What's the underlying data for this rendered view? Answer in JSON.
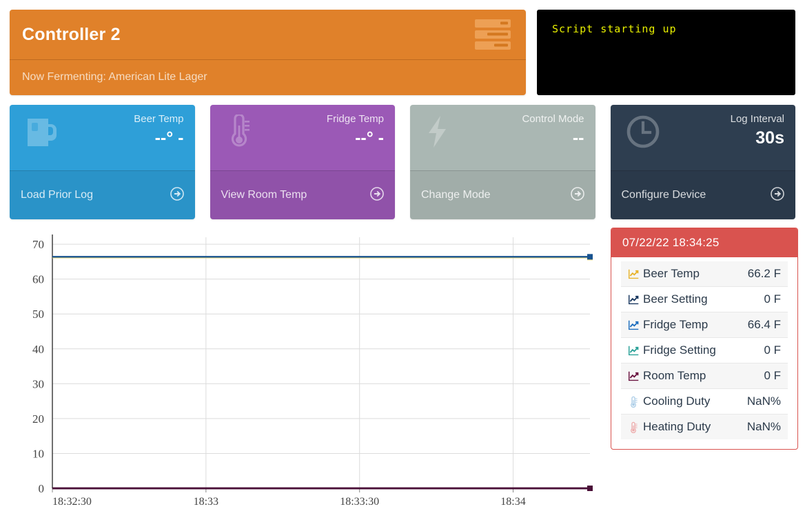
{
  "controller": {
    "title": "Controller 2",
    "subtitle": "Now Fermenting: American Lite Lager",
    "icon": "server-icon",
    "bg_color": "#e0812a"
  },
  "lcd": {
    "line1": "Script starting up",
    "line2": "",
    "line3": "",
    "line4": "",
    "text_color": "#e8f000",
    "bg_color": "#000000"
  },
  "cards": [
    {
      "label": "Beer Temp",
      "value": "--° -",
      "footer": "Load Prior Log",
      "icon": "beer-mug-icon",
      "color": "#2e9fd8"
    },
    {
      "label": "Fridge Temp",
      "value": "--° -",
      "footer": "View Room Temp",
      "icon": "thermometer-icon",
      "color": "#9b59b6"
    },
    {
      "label": "Control Mode",
      "value": "--",
      "footer": "Change Mode",
      "icon": "lightning-bolt-icon",
      "color": "#aab7b3"
    },
    {
      "label": "Log Interval",
      "value": "30s",
      "footer": "Configure Device",
      "icon": "clock-icon",
      "color": "#2e3e50"
    }
  ],
  "panel": {
    "timestamp": "07/22/22 18:34:25",
    "header_color": "#d9534f",
    "rows": [
      {
        "label": "Beer Temp",
        "value": "66.2 F",
        "icon": "chart-line-icon",
        "icon_color": "#e8b42e"
      },
      {
        "label": "Beer Setting",
        "value": "0 F",
        "icon": "chart-line-icon",
        "icon_color": "#18375f"
      },
      {
        "label": "Fridge Temp",
        "value": "66.4 F",
        "icon": "chart-line-icon",
        "icon_color": "#1f6fbf"
      },
      {
        "label": "Fridge Setting",
        "value": "0 F",
        "icon": "chart-line-icon",
        "icon_color": "#2aa198"
      },
      {
        "label": "Room Temp",
        "value": "0 F",
        "icon": "chart-line-icon",
        "icon_color": "#6b1440"
      },
      {
        "label": "Cooling Duty",
        "value": "NaN%",
        "icon": "thermometer-icon",
        "icon_color": "#a8cbe6"
      },
      {
        "label": "Heating Duty",
        "value": "NaN%",
        "icon": "thermometer-icon",
        "icon_color": "#eda9a9"
      }
    ]
  },
  "chart_data": {
    "type": "line",
    "title": "",
    "xlabel": "",
    "ylabel": "",
    "grid": true,
    "legend": "none",
    "ylim": [
      0,
      72
    ],
    "yticks": [
      0,
      10,
      20,
      30,
      40,
      50,
      60,
      70
    ],
    "xticks": [
      "18:32:30",
      "18:33",
      "18:33:30",
      "18:34"
    ],
    "x": [
      "18:32:30",
      "18:33",
      "18:33:30",
      "18:34",
      "18:34:25"
    ],
    "series": [
      {
        "name": "Fridge Temp",
        "color": "#18538f",
        "values": [
          66.4,
          66.4,
          66.4,
          66.4,
          66.4
        ]
      },
      {
        "name": "Beer Temp",
        "color": "#e8d87e",
        "values": [
          66.2,
          66.2,
          66.2,
          66.2,
          66.2
        ]
      },
      {
        "name": "Room Temp",
        "color": "#4a1038",
        "values": [
          0,
          0,
          0,
          0,
          0
        ]
      },
      {
        "name": "Beer Setting",
        "color": "#4a1038",
        "values": [
          0,
          0,
          0,
          0,
          0
        ]
      },
      {
        "name": "Fridge Setting",
        "color": "#4a1038",
        "values": [
          0,
          0,
          0,
          0,
          0
        ]
      }
    ]
  }
}
